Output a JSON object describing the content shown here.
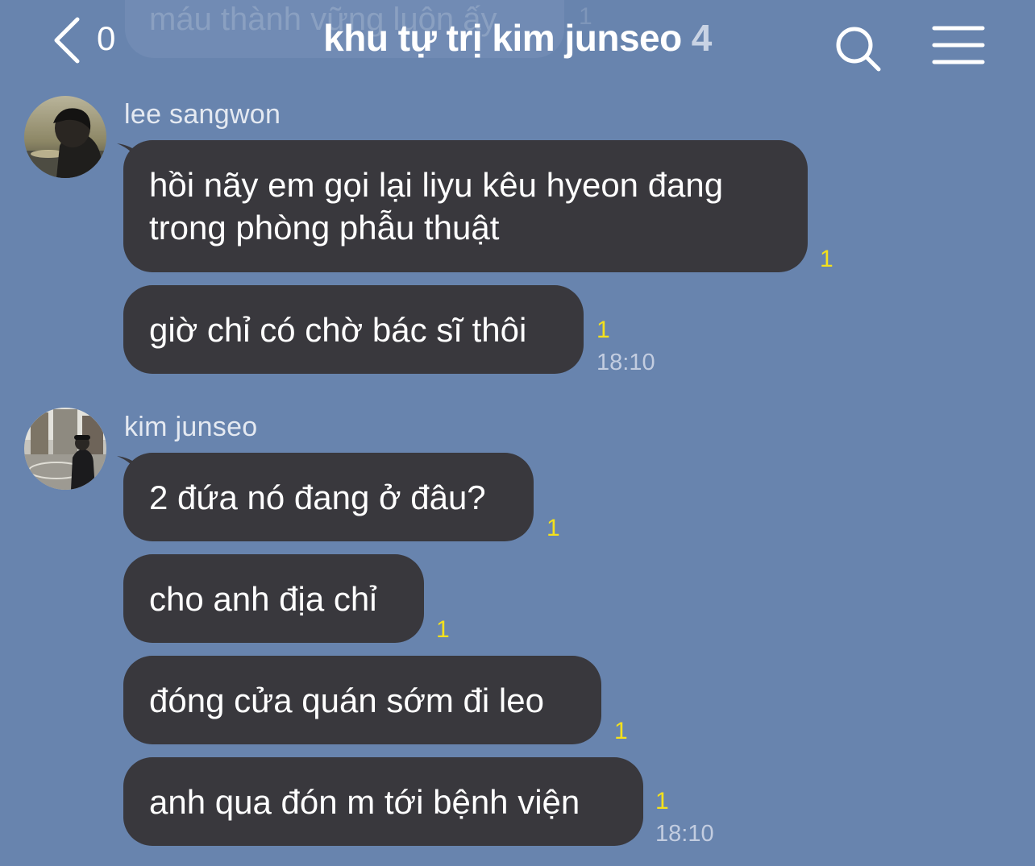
{
  "header": {
    "back_count": "0",
    "title": "khu tự trị kim junseo",
    "member_count": "4"
  },
  "scrolled_message": {
    "text": "máu thành vững luôn ấy",
    "read_count": "1"
  },
  "groups": [
    {
      "sender": "lee sangwon",
      "messages": [
        {
          "text": "hồi nãy em gọi lại liyu kêu hyeon đang trong phòng phẫu thuật",
          "read": "1",
          "time": ""
        },
        {
          "text": "giờ chỉ có chờ bác sĩ thôi",
          "read": "1",
          "time": "18:10"
        }
      ]
    },
    {
      "sender": "kim junseo",
      "messages": [
        {
          "text": "2 đứa nó đang ở đâu?",
          "read": "1",
          "time": ""
        },
        {
          "text": "cho anh địa chỉ",
          "read": "1",
          "time": ""
        },
        {
          "text": "đóng cửa quán sớm đi leo",
          "read": "1",
          "time": ""
        },
        {
          "text": "anh qua đón m tới bệnh viện",
          "read": "1",
          "time": "18:10"
        }
      ]
    }
  ],
  "icons": {
    "back": "chevron-left-icon",
    "search": "search-icon",
    "menu": "hamburger-menu-icon"
  },
  "colors": {
    "background": "#6884ae",
    "bubble": "#39383d",
    "read_indicator": "#f4e11b"
  }
}
